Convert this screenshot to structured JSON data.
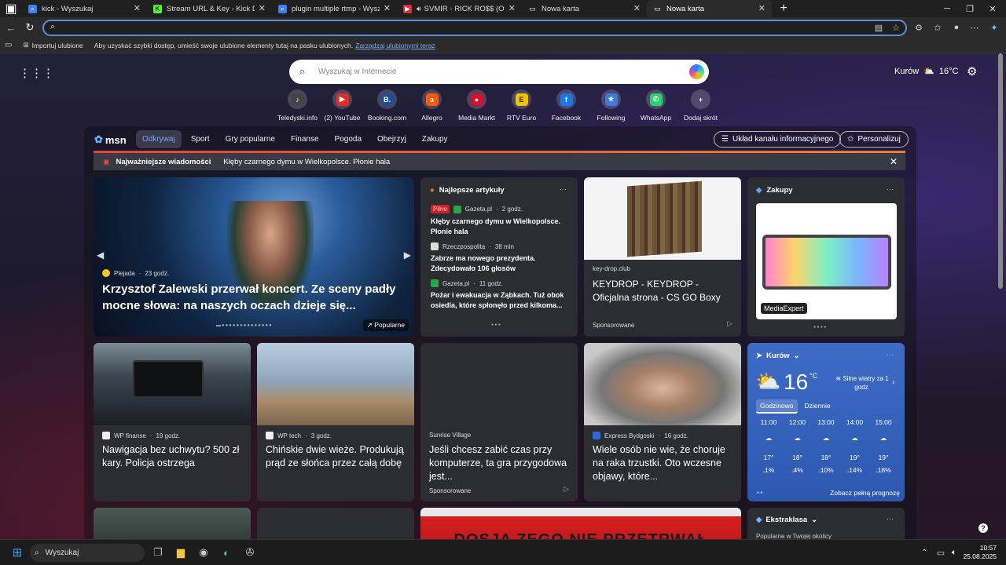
{
  "tabs": [
    {
      "title": "kick - Wyszukaj",
      "icon": "search-icon"
    },
    {
      "title": "Stream URL & Key - Kick Dashboard",
      "icon": "kick-icon"
    },
    {
      "title": "plugin multiple rtmp - Wyszukaj",
      "icon": "search-icon"
    },
    {
      "title": "SVMIR - RICK RO$$ (Offic",
      "icon": "youtube-icon"
    },
    {
      "title": "Nowa karta",
      "icon": "newtab-icon"
    },
    {
      "title": "Nowa karta",
      "icon": "newtab-icon"
    }
  ],
  "address": {
    "value": ""
  },
  "favorites": {
    "import_label": "Importuj ulubione",
    "hint": "Aby uzyskać szybki dostęp, umieść swoje ulubione elementy tutaj na pasku ulubionych.",
    "link": "Zarządzaj ulubionymi teraz"
  },
  "search": {
    "placeholder": "Wyszukaj w Internecie"
  },
  "weather_top": {
    "city": "Kurów",
    "temp": "16°C"
  },
  "shortcuts": [
    {
      "label": "Teledyski.info",
      "glyph": "♪",
      "color": "#444"
    },
    {
      "label": "(2) YouTube",
      "glyph": "▶",
      "color": "#e52d27"
    },
    {
      "label": "Booking.com",
      "glyph": "B.",
      "color": "#1d4d9c"
    },
    {
      "label": "Allegro",
      "glyph": "a",
      "color": "#ff5a00"
    },
    {
      "label": "Media Markt",
      "glyph": "●",
      "color": "#d5102a"
    },
    {
      "label": "RTV Euro",
      "glyph": "E",
      "color": "#f4c400"
    },
    {
      "label": "Facebook",
      "glyph": "f",
      "color": "#1877f2"
    },
    {
      "label": "Following",
      "glyph": "★",
      "color": "#3b7ae5"
    },
    {
      "label": "WhatsApp",
      "glyph": "✆",
      "color": "#25d366"
    },
    {
      "label": "Dodaj skrót",
      "glyph": "+",
      "color": "transparent"
    }
  ],
  "feed": {
    "logo": "msn",
    "categories": [
      "Odkrywaj",
      "Sport",
      "Gry popularne",
      "Finanse",
      "Pogoda",
      "Obejrzyj",
      "Zakupy"
    ],
    "layout_btn": "Układ kanału informacyjnego",
    "personalize_btn": "Personalizuj",
    "breaking_label": "Najważniejsze wiadomości",
    "breaking_text": "Kłęby czarnego dymu w Wielkopolsce. Płonie hala",
    "hero": {
      "source": "Plejada",
      "time": "23 godz.",
      "title": "Krzysztof Zalewski przerwał koncert. Ze sceny padły mocne słowa: na naszych oczach dzieje się...",
      "badge": "Popularne"
    },
    "top": {
      "heading": "Najlepsze artykuły",
      "items": [
        {
          "tag": "Pilne",
          "source": "Gazeta.pl",
          "time": "2 godz.",
          "title": "Kłęby czarnego dymu w Wielkopolsce. Płonie hala"
        },
        {
          "source": "Rzeczpospolita",
          "time": "38 min",
          "title": "Zabrze ma nowego prezydenta. Zdecydowało 106 głosów"
        },
        {
          "source": "Gazeta.pl",
          "time": "11 godz.",
          "title": "Pożar i ewakuacja w Ząbkach. Tuż obok osiedla, które spłonęło przed kilkoma..."
        }
      ]
    },
    "ad": {
      "domain": "key-drop.club",
      "title": "KEYDROP - KEYDROP - Oficjalna strona - CS GO Boxy",
      "sponsored": "Sponsorowane"
    },
    "shop": {
      "heading": "Zakupy",
      "brand": "MediaExpert"
    },
    "row2": [
      {
        "source": "WP finanse",
        "time": "19 godz.",
        "title": "Nawigacja bez uchwytu? 500 zł kary. Policja ostrzega"
      },
      {
        "source": "WP tech",
        "time": "3 godz.",
        "title": "Chińskie dwie wieże. Produkują prąd ze słońca przez całą dobę"
      },
      {
        "source": "Sunrise Village",
        "title": "Jeśli chcesz zabić czas przy komputerze, ta gra przygodowa jest...",
        "sponsored": "Sponsorowane"
      },
      {
        "source": "Express Bydgoski",
        "time": "16 godz.",
        "title": "Wiele osób nie wie, że choruje na raka trzustki. Oto wczesne objawy, które..."
      }
    ],
    "weather": {
      "city": "Kurów",
      "temp": "16",
      "unit": "°C",
      "wind": "Silne wiatry za 1 godz.",
      "tabs": [
        "Godzinowo",
        "Dziennie"
      ],
      "hours": [
        {
          "h": "11:00",
          "t": "17°",
          "p": "1%"
        },
        {
          "h": "12:00",
          "t": "18°",
          "p": "4%"
        },
        {
          "h": "13:00",
          "t": "18°",
          "p": "10%"
        },
        {
          "h": "14:00",
          "t": "19°",
          "p": "14%"
        },
        {
          "h": "15:00",
          "t": "19°",
          "p": "18%"
        }
      ],
      "forecast_btn": "Zobacz pełną prognozę"
    },
    "extra": {
      "heading": "Ekstraklasa",
      "sub": "Popularne w Twojej okolicy"
    },
    "bottom_text": "DOSJA ZEGO NIE PRZETRWAŁ"
  },
  "taskbar": {
    "search": "Wyszukaj",
    "time": "10:57",
    "date": "25.08.2025"
  }
}
